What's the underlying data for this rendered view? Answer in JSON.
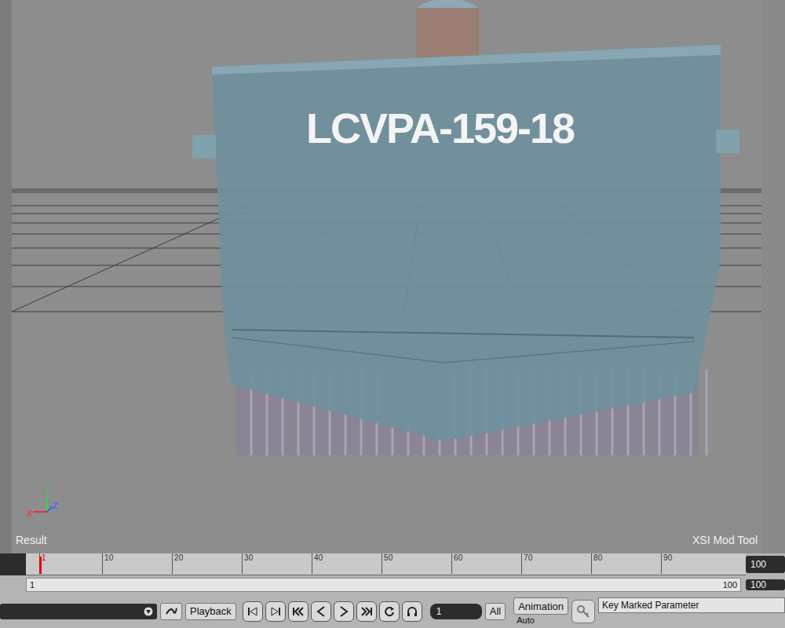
{
  "viewport": {
    "label": "Result",
    "brand": "XSI Mod Tool",
    "hull_label": "LCVPA-159-18",
    "axes": {
      "y": "Y",
      "x": "X",
      "z": "Z"
    }
  },
  "timeline": {
    "ticks": [
      "1",
      "10",
      "20",
      "30",
      "40",
      "50",
      "60",
      "70",
      "80",
      "90"
    ],
    "playhead_level": 0,
    "end_field": "100"
  },
  "range": {
    "start": "1",
    "end": "100",
    "end_field": "100",
    "level": 1
  },
  "playback": {
    "button": "Playback",
    "current_frame": "1",
    "all_button": "All",
    "animation_button": "Animation",
    "auto_label": "Auto",
    "key_label": "Key Marked Parameter"
  }
}
